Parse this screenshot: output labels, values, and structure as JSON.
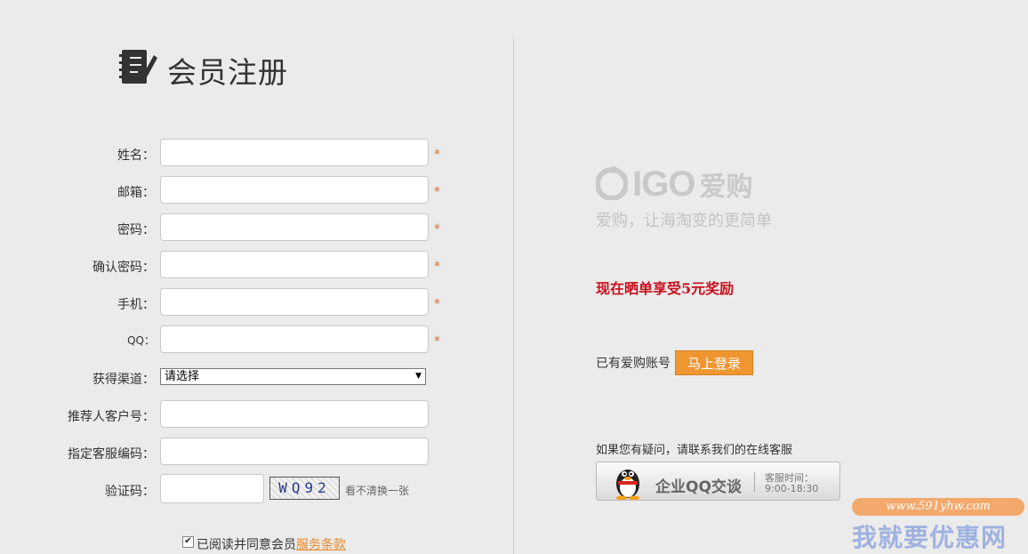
{
  "page": {
    "title": "会员注册"
  },
  "form": {
    "fields": [
      {
        "label": "姓名：",
        "value": "",
        "required_mark": "*"
      },
      {
        "label": "邮箱：",
        "value": "",
        "required_mark": "*"
      },
      {
        "label": "密码：",
        "value": "",
        "required_mark": "*"
      },
      {
        "label": "确认密码：",
        "value": "",
        "required_mark": "*"
      },
      {
        "label": "手机：",
        "value": "",
        "required_mark": "*"
      },
      {
        "label": "QQ：",
        "value": "",
        "required_mark": "*"
      }
    ],
    "channel": {
      "label": "获得渠道：",
      "selected": "请选择"
    },
    "referrer": {
      "label": "推荐人客户号：",
      "value": ""
    },
    "service": {
      "label": "指定客服编码：",
      "value": ""
    },
    "captcha": {
      "label": "验证码：",
      "value": "",
      "image_text": "WQ92",
      "refresh": "看不清换一张"
    },
    "agree": {
      "text": "已阅读并同意会员",
      "link": "服务条款",
      "checked": true
    }
  },
  "right": {
    "logo_text": "IGO",
    "logo_cn": "爱购",
    "slogan": "爱购，让海淘变的更简单",
    "promo": "现在晒单享受5元奖励",
    "has_account": "已有爱购账号",
    "login_button": "马上登录",
    "help_text": "如果您有疑问，请联系我们的在线客服",
    "qq": {
      "label": "企业QQ交谈",
      "time_title": "客服时间：",
      "time_range": "9:00-18:30"
    }
  },
  "watermark": {
    "url": "www.591yhw.com",
    "text": "我就要优惠网"
  },
  "colors": {
    "accent": "#ef9631",
    "promo": "#c8101e",
    "required": "#e06b1f"
  }
}
